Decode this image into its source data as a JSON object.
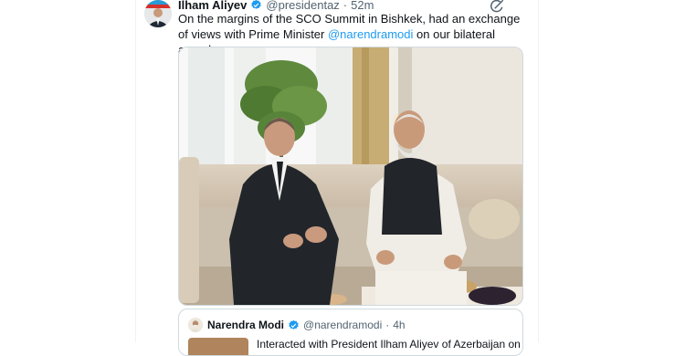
{
  "tweet": {
    "author_name": "Ilham Aliyev",
    "author_handle": "@presidentaz",
    "separator": "·",
    "time": "52m",
    "text_before": "On the margins of the SCO Summit in Bishkek, had an exchange of views with Prime Minister ",
    "mention": "@narendramodi",
    "text_after": " on our bilateral agenda."
  },
  "quoted_tweet": {
    "author_name": "Narendra Modi",
    "author_handle": "@narendramodi",
    "separator": "·",
    "time": "4h",
    "text": "Interacted with President Ilham Aliyev of Azerbaijan on"
  },
  "icons": {
    "verified": "verified-badge-icon",
    "grok": "grok-icon",
    "flag": "azerbaijan-flag-icon"
  },
  "colors": {
    "text": "#0f1419",
    "secondary": "#536471",
    "link": "#1d9bf0",
    "verified": "#1d9bf0",
    "border": "#cfd9de"
  }
}
